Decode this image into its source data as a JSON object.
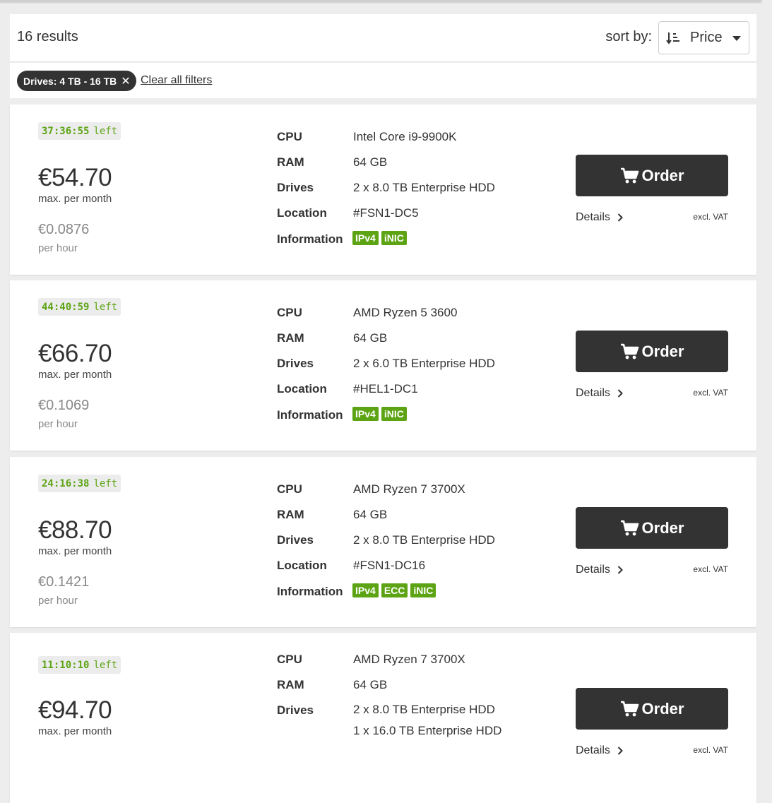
{
  "header": {
    "results": "16 results",
    "sort_label": "sort by:",
    "sort_value": "Price"
  },
  "filters": {
    "chip": "Drives: 4 TB - 16 TB",
    "clear": "Clear all filters"
  },
  "labels": {
    "cpu": "CPU",
    "ram": "RAM",
    "drives": "Drives",
    "location": "Location",
    "information": "Information",
    "left": "left",
    "max_per_month": "max. per month",
    "per_hour": "per hour",
    "order": "Order",
    "details": "Details",
    "excl_vat": "excl. VAT"
  },
  "colors": {
    "accent": "#5da414",
    "button": "#333333"
  },
  "servers": [
    {
      "timer": "37:36:55",
      "price": "€54.70",
      "hourly": "€0.0876",
      "cpu": "Intel Core i9-9900K",
      "ram": "64 GB",
      "drives": [
        "2 x 8.0 TB Enterprise HDD"
      ],
      "location": "#FSN1-DC5",
      "badges": [
        "IPv4",
        "iNIC"
      ]
    },
    {
      "timer": "44:40:59",
      "price": "€66.70",
      "hourly": "€0.1069",
      "cpu": "AMD Ryzen 5 3600",
      "ram": "64 GB",
      "drives": [
        "2 x 6.0 TB Enterprise HDD"
      ],
      "location": "#HEL1-DC1",
      "badges": [
        "IPv4",
        "iNIC"
      ]
    },
    {
      "timer": "24:16:38",
      "price": "€88.70",
      "hourly": "€0.1421",
      "cpu": "AMD Ryzen 7 3700X",
      "ram": "64 GB",
      "drives": [
        "2 x 8.0 TB Enterprise HDD"
      ],
      "location": "#FSN1-DC16",
      "badges": [
        "IPv4",
        "ECC",
        "iNIC"
      ]
    },
    {
      "timer": "11:10:10",
      "price": "€94.70",
      "hourly": "",
      "cpu": "AMD Ryzen 7 3700X",
      "ram": "64 GB",
      "drives": [
        "2 x 8.0 TB Enterprise HDD",
        "1 x 16.0 TB Enterprise HDD"
      ],
      "location": "",
      "badges": []
    }
  ]
}
